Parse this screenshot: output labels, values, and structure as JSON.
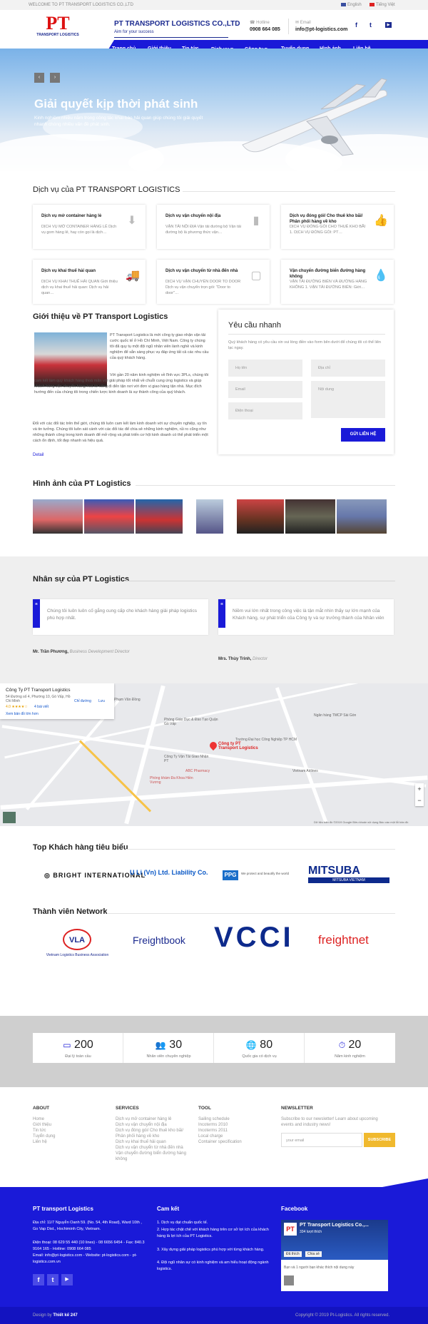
{
  "topbar": {
    "welcome": "WELCOME TO PT TRANSPORT LOGISTICS CO.,LTD",
    "lang_en": "English",
    "lang_vi": "Tiếng Việt"
  },
  "header": {
    "brand": "PT TRANSPORT LOGISTICS CO.,LTD",
    "tagline": "Aim for your success",
    "hotline_label": "Hotline",
    "hotline": "0908 664 085",
    "email_label": "Email",
    "email": "info@pt-logistics.com",
    "logo_text": "PT",
    "logo_sub": "TRANSPORT LOGISTICS"
  },
  "nav": [
    "Trang chủ",
    "Giới thiệu",
    "Tin tức",
    "Dịch vụ ▾",
    "Công ty ▾",
    "Tuyển dụng",
    "Hình ảnh",
    "Liên hệ"
  ],
  "hero": {
    "title": "Giải quyết kịp thời phát sinh",
    "subtitle": "Kinh nghiệm nhiều năm trong công tác khai báo hải quan giúp chúng tôi giải quyết nhanh chóng nhiều vấn đề phát sinh.",
    "prev": "‹",
    "next": "›"
  },
  "services": {
    "title": "Dịch vụ của PT TRANSPORT LOGISTICS",
    "items": [
      {
        "t": "Dịch vụ mở container hàng lẻ",
        "d": "DỊCH VỤ MỞ CONTAINER HÀNG LẺ Dịch vụ gom hàng lẻ, hay còn gọi là dịch…",
        "icon": "⬇"
      },
      {
        "t": "Dịch vụ vận chuyển nội địa",
        "d": "VẬN TẢI NỘI ĐỊA Vận tải đường bộ Vận tải đường bộ là phương thức vận…",
        "icon": "▮"
      },
      {
        "t": "Dịch vụ đóng gói/ Cho thuê kho bãi/ Phân phối hàng về kho",
        "d": "DỊCH VỤ ĐÓNG GÓI CHO THUÊ KHO BÃI 1. DỊCH VỤ ĐÓNG GÓI: PT…",
        "icon": "👍"
      },
      {
        "t": "Dịch vụ khai thuế hải quan",
        "d": "DỊCH VỤ KHAI THUẾ HẢI QUAN Giới thiệu dịch vụ khai thuế hải quan: Dịch vụ hải quan…",
        "icon": "🚚"
      },
      {
        "t": "Dịch vụ vận chuyển từ nhà đến nhà",
        "d": "DỊCH VỤ VẬN CHUYỂN DOOR TO DOOR Dịch vụ vận chuyển trọn gói: \"Door to door\"…",
        "icon": "▢"
      },
      {
        "t": "Vận chuyển đường biển đường hàng không",
        "d": "VẬN TẢI ĐƯỜNG BIỂN VÀ ĐƯỜNG HÀNG KHÔNG 1. VẬN TẢI ĐƯỜNG BIỂN: Giới…",
        "icon": "💧"
      }
    ]
  },
  "intro": {
    "title": "Giới thiệu về PT Transport Logistics",
    "p1": "PT Transport Logistics là mới công ty giao nhận vận tải cước quốc tế ở Hồ Chí Minh, Việt Nam. Công ty chúng tôi đã quy tụ một đội ngũ nhân viên lành nghề và kinh nghiệm để sẵn sàng phục vụ đáp ứng tất cả các nhu cầu của quý khách hàng.",
    "p2": "Với gần 20 năm kinh nghiệm về lĩnh vực 3PLs, chúng tôi cam kết làm quý khách hàng thoả mãn với giải pháp tốt nhất về chuỗi cung ứng logistics và giúp khách hàng vận chuyển hàng hoá từ cảng đi đến tận nơi với đơn vị giao hàng tận nhà. Mục đích hướng đến của chúng tôi trong chiến lược kinh doanh là sự thành công của quý khách.",
    "p3": "Đối với các đối tác trên thế giới, chúng tôi luôn cam kết làm kinh doanh với sự chuyên nghiệp, uy tín và tin tưởng. Chúng tôi luôn sát cánh với các đối tác để chia sẻ những kinh nghiệm, rủi ro cũng như những thành công trong kinh doanh để mở rộng và phát triển cơ hội kinh doanh có thể phát triển một cách ổn định, tốt đẹp nhanh và hiệu quả.",
    "more": "Detail"
  },
  "form": {
    "title": "Yêu cầu nhanh",
    "desc": "Quý khách hàng có yêu cầu xin vui lòng điền vào form bên dưới để chúng tôi có thể liên lạc ngay.",
    "name": "Họ tên",
    "address": "Địa chỉ",
    "email": "Email",
    "content": "Nội dung",
    "phone": "Điện thoại",
    "submit": "GỬI LIÊN HỆ"
  },
  "gallery": {
    "title": "Hình ảnh của PT Logistics"
  },
  "staff": {
    "title": "Nhân sự của PT Logistics",
    "quotes": [
      {
        "text": "Chúng tôi luôn luôn cố gắng cung cấp cho khách hàng giải pháp logistics phù hợp nhất.",
        "name": "Mr. Trần Phương,",
        "role": "Business Development Director"
      },
      {
        "text": "Niềm vui lớn nhất trong công việc là tận mắt nhìn thấy sự lớn mạnh của Khách hàng, sự phát triển của Công ty và sự trưởng thành của Nhân viên",
        "name": "Mrs. Thùy Trinh,",
        "role": "Director"
      }
    ]
  },
  "map": {
    "name": "Công Ty PT Transport Logistics",
    "address": "54 Đường số 4, Phường 10, Gò Vấp, Hồ Chí Minh",
    "rating": "4.0 ★★★★☆",
    "reviews": "4 bài viết",
    "enlarge": "Xem bản đồ lớn hơn",
    "directions": "Chỉ đường",
    "save": "Lưu",
    "marker": "Công ty PT Transport Logistics",
    "labels": [
      "Phạm Văn Đồng",
      "Phòng Giáo Dục & Đào Tạo Quận Gò Vấp",
      "Công Ty Vận Tải Giao Nhận PT",
      "Phòng khám Đa Khoa Hiền Vương",
      "Ngân hàng TMCP Sài Gòn",
      "ABC Pharmacy",
      "Vietnam Airlines",
      "Trường Đại học Công Nghiệp TP HCM"
    ],
    "footer": "Dữ liệu bản đồ ©2019 Google  Điều khoản sử dụng  Báo cáo một lỗi bản đồ",
    "zoom_in": "+",
    "zoom_out": "−"
  },
  "clients": {
    "title": "Top Khách hàng tiêu biểu",
    "logos": [
      "BRIGHT INTERNATIONAL",
      "U Li (Vn) Ltd. Liability Co.",
      "PPG",
      "MITSUBA"
    ],
    "ppg_tag": "We protect and beautify the world",
    "mitsuba_sub": "MITSUBA VIETNAM"
  },
  "network": {
    "title": "Thành viên Network",
    "logos": [
      "VLA",
      "Freightbook",
      "VCCI",
      "freightnet"
    ],
    "vla_sub": "Vietnam Logistics Business Association"
  },
  "stats": [
    {
      "num": "200",
      "lab": "Đại lý toàn cầu",
      "icon": "▭"
    },
    {
      "num": "30",
      "lab": "Nhân viên chuyên nghiệp",
      "icon": "👥"
    },
    {
      "num": "80",
      "lab": "Quốc gia có dịch vụ",
      "icon": "🌐"
    },
    {
      "num": "20",
      "lab": "Năm kinh nghiệm",
      "icon": "⏱"
    }
  ],
  "footer_cols": {
    "about": {
      "h": "ABOUT",
      "items": [
        "Home",
        "Giới thiệu",
        "Tin tức",
        "Tuyển dụng",
        "Liên hệ"
      ]
    },
    "services": {
      "h": "SERVICES",
      "items": [
        "Dịch vụ mở container hàng lẻ",
        "Dịch vụ vận chuyển nội địa",
        "Dịch vụ đóng gói/ Cho thuê kho bãi/ Phân phối hàng về kho",
        "Dịch vụ khai thuế hải quan",
        "Dịch vụ vận chuyển từ nhà đến nhà",
        "Vận chuyển đường biển đường hàng không"
      ]
    },
    "tool": {
      "h": "TOOL",
      "items": [
        "Sailing schedule",
        "Incoterms 2010",
        "Incoterms 2011",
        "Local charge",
        "Container specification"
      ]
    },
    "newsletter": {
      "h": "NEWSLETTER",
      "desc": "Subscribe to our newsletter! Learn about upcoming events and industry news!",
      "placeholder": "your email",
      "button": "SUBSCRIBE"
    }
  },
  "bluefoot": {
    "company": {
      "h": "PT transport Logistics",
      "lines": [
        "Địa chỉ: 11/7 Nguyễn Oanh 59. (No. 54, 4th Road), Ward 10th , Go Vap Dist., Hochiminh City, Vietnam.",
        "Điện thoại: 08 629 55 440 (10 lines) - 08 6656 6454 - Fax: 840.3 9164 165  -  Hotline: 0908 664 085",
        "Email: info@pt-logistics.com  -  Website: pt-logistics.com  -  pt-logistics.com.vn"
      ]
    },
    "commit": {
      "h": "Cam kết",
      "lines": [
        "1. Dịch vụ đạt chuẩn quốc tế.",
        "2. Hợp tác chặt chẽ với khách hàng trên cơ sở lợi ích của khách hàng là lợi ích của PT Logistics.",
        "3. Xây dựng giải pháp logistics phù hợp với từng khách hàng.",
        "4. Đội ngũ nhân sự có kinh nghiệm và am hiểu hoạt động ngành logistics."
      ]
    },
    "facebook": {
      "h": "Facebook",
      "page": "PT Transport Logistics Co.,...",
      "likes": "334 lượt thích",
      "liked": "Đã thích",
      "share": "Chia sẻ",
      "friend": "Bạn và 1 người bạn khác thích nội dung này"
    }
  },
  "bottom": {
    "left_label": "Design by",
    "left_brand": "Thiết kế 247",
    "right": "Copyright © 2019 Pt-Logistics. All rights reserved."
  },
  "colors": {
    "primary": "#1a1ad8",
    "dark": "#1b2a8f",
    "accent": "#f0b92e"
  }
}
